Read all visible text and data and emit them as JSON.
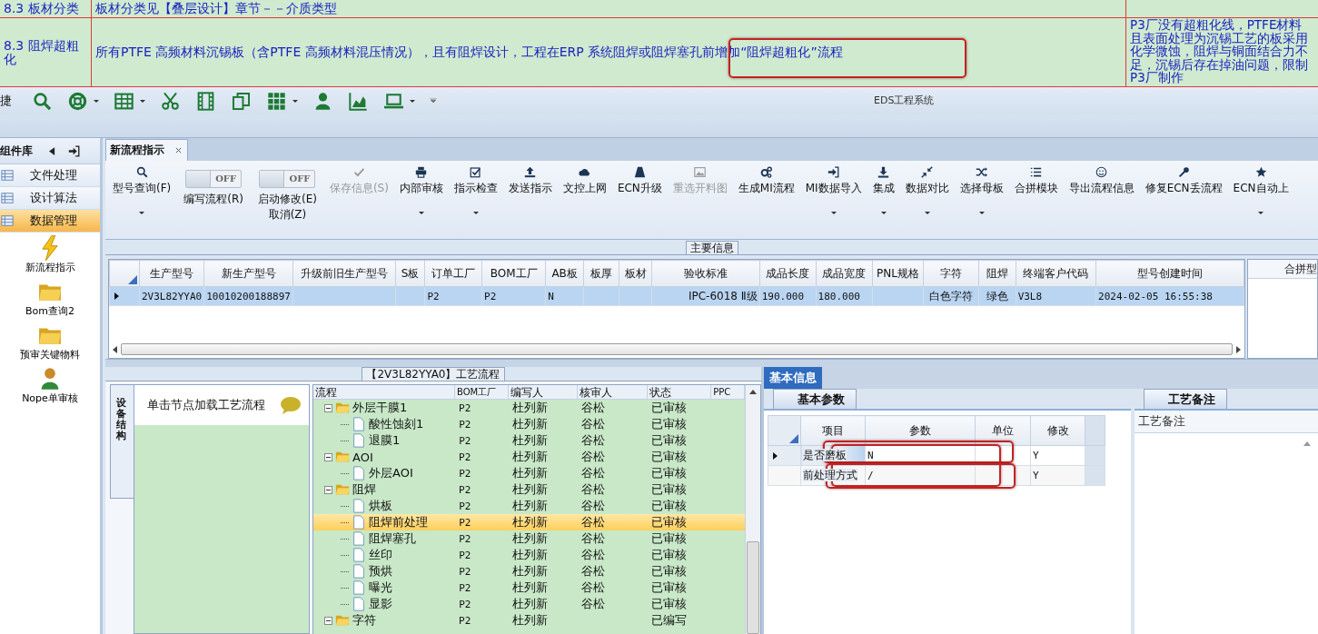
{
  "document_table": {
    "rows": [
      {
        "section": "8.3 板材分类",
        "content": "板材分类见【叠层设计】章节－－介质类型"
      },
      {
        "section": "8.3 阻焊超粗化",
        "content": "所有PTFE 高频材料沉锡板（含PTFE 高频材料混压情况），且有阻焊设计，工程在ERP 系统阻焊或阻焊塞孔前增加“阻焊超粗化”流程",
        "note": "P3厂没有超粗化线，PTFE材料且表面处理为沉锡工艺的板采用化学微蚀，阻焊与铜面结合力不足，沉锡后存在掉油问题，限制P3厂制作"
      }
    ]
  },
  "quick_toolbar": {
    "label": "捷"
  },
  "window": {
    "title": "EDS工程系统"
  },
  "sidebar": {
    "title": "组件库",
    "items": [
      {
        "label": "文件处理",
        "selected": false
      },
      {
        "label": "设计算法",
        "selected": false
      },
      {
        "label": "数据管理",
        "selected": true
      }
    ],
    "shortcuts": [
      "新流程指示",
      "Bom查询2",
      "预审关键物料",
      "Nope单审核"
    ]
  },
  "tabs": [
    {
      "label": "新流程指示",
      "selected": true
    }
  ],
  "ribbon": [
    {
      "kind": "button",
      "label": "型号查询(F)",
      "dropdown": true,
      "disabled": false
    },
    {
      "kind": "toggle",
      "label": "编写流程(R)",
      "state_label": "OFF",
      "on": false
    },
    {
      "kind": "toggle",
      "label": "启动修改(E)",
      "label2": "取消(Z)",
      "state_label": "OFF",
      "on": false
    },
    {
      "kind": "button",
      "label": "保存信息(S)",
      "dropdown": false,
      "disabled": true
    },
    {
      "kind": "button",
      "label": "内部审核",
      "dropdown": true,
      "disabled": false
    },
    {
      "kind": "button",
      "label": "指示检查",
      "dropdown": true,
      "disabled": false
    },
    {
      "kind": "button",
      "label": "发送指示",
      "dropdown": false,
      "disabled": false
    },
    {
      "kind": "button",
      "label": "文控上网",
      "dropdown": false,
      "disabled": false
    },
    {
      "kind": "button",
      "label": "ECN升级",
      "dropdown": false,
      "disabled": false
    },
    {
      "kind": "button",
      "label": "重选开料图",
      "dropdown": false,
      "disabled": true
    },
    {
      "kind": "button",
      "label": "生成MI流程",
      "dropdown": false,
      "disabled": false
    },
    {
      "kind": "button",
      "label": "MI数据导入",
      "dropdown": true,
      "disabled": false
    },
    {
      "kind": "button",
      "label": "集成",
      "dropdown": true,
      "disabled": false
    },
    {
      "kind": "button",
      "label": "数据对比",
      "dropdown": true,
      "disabled": false
    },
    {
      "kind": "button",
      "label": "选择母板",
      "dropdown": true,
      "disabled": false
    },
    {
      "kind": "button",
      "label": "合拼模块",
      "dropdown": false,
      "disabled": false
    },
    {
      "kind": "button",
      "label": "导出流程信息",
      "dropdown": false,
      "disabled": false
    },
    {
      "kind": "button",
      "label": "修复ECN丢流程",
      "dropdown": false,
      "disabled": false
    },
    {
      "kind": "button",
      "label": "ECN自动上",
      "dropdown": true,
      "disabled": false
    }
  ],
  "main_info": {
    "title": "主要信息",
    "columns": [
      "生产型号",
      "新生产型号",
      "升级前旧生产型号",
      "S板",
      "订单工厂",
      "BOM工厂",
      "AB板",
      "板厚",
      "板材",
      "验收标准",
      "成品长度",
      "成品宽度",
      "PNL规格",
      "字符",
      "阻焊",
      "终端客户代码",
      "型号创建时间"
    ],
    "rows": [
      {
        "selected": true,
        "cells": [
          "2V3L82YYA0",
          "10010200188897",
          null,
          null,
          "P2",
          "P2",
          "N",
          null,
          null,
          "IPC-6018 Ⅱ级",
          "190.000",
          "180.000",
          null,
          "白色字符",
          "绿色",
          "V3L8",
          "2024-02-05 16:55:38"
        ]
      }
    ],
    "side_panel": {
      "title": "合拼型"
    }
  },
  "process_panel": {
    "title": "【2V3L82YYA0】工艺流程",
    "side_tab": "设备结构",
    "hint": "单击节点加载工艺流程",
    "columns": [
      "流程",
      "BOM工厂",
      "编写人",
      "核审人",
      "状态",
      "PPC"
    ],
    "nodes": [
      {
        "kind": "folder",
        "label": "外层干膜1",
        "bom": "P2",
        "author": "杜列新",
        "reviewer": "谷松",
        "status": "已审核",
        "selected": false,
        "expanded": true,
        "children": [
          {
            "kind": "file",
            "label": "酸性蚀刻1",
            "bom": "P2",
            "author": "杜列新",
            "reviewer": "谷松",
            "status": "已审核",
            "selected": false
          },
          {
            "kind": "file",
            "label": "退膜1",
            "bom": "P2",
            "author": "杜列新",
            "reviewer": "谷松",
            "status": "已审核",
            "selected": false
          }
        ]
      },
      {
        "kind": "folder",
        "label": "AOI",
        "bom": "P2",
        "author": "杜列新",
        "reviewer": "谷松",
        "status": "已审核",
        "selected": false,
        "expanded": true,
        "children": [
          {
            "kind": "file",
            "label": "外层AOI",
            "bom": "P2",
            "author": "杜列新",
            "reviewer": "谷松",
            "status": "已审核",
            "selected": false
          }
        ]
      },
      {
        "kind": "folder",
        "label": "阻焊",
        "bom": "P2",
        "author": "杜列新",
        "reviewer": "谷松",
        "status": "已审核",
        "selected": false,
        "expanded": true,
        "children": [
          {
            "kind": "file",
            "label": "烘板",
            "bom": "P2",
            "author": "杜列新",
            "reviewer": "谷松",
            "status": "已审核",
            "selected": false
          },
          {
            "kind": "file",
            "label": "阻焊前处理",
            "bom": "P2",
            "author": "杜列新",
            "reviewer": "谷松",
            "status": "已审核",
            "selected": true
          },
          {
            "kind": "file",
            "label": "阻焊塞孔",
            "bom": "P2",
            "author": "杜列新",
            "reviewer": "谷松",
            "status": "已审核",
            "selected": false
          },
          {
            "kind": "file",
            "label": "丝印",
            "bom": "P2",
            "author": "杜列新",
            "reviewer": "谷松",
            "status": "已审核",
            "selected": false
          },
          {
            "kind": "file",
            "label": "预烘",
            "bom": "P2",
            "author": "杜列新",
            "reviewer": "谷松",
            "status": "已审核",
            "selected": false
          },
          {
            "kind": "file",
            "label": "曝光",
            "bom": "P2",
            "author": "杜列新",
            "reviewer": "谷松",
            "status": "已审核",
            "selected": false
          },
          {
            "kind": "file",
            "label": "显影",
            "bom": "P2",
            "author": "杜列新",
            "reviewer": "谷松",
            "status": "已审核",
            "selected": false
          }
        ]
      },
      {
        "kind": "folder",
        "label": "字符",
        "bom": "P2",
        "author": "杜列新",
        "status": "已编写",
        "selected": false,
        "expanded": true
      }
    ]
  },
  "detail": {
    "tab": "基本信息",
    "params_tab": "基本参数",
    "columns": [
      "项目",
      "参数",
      "单位",
      "修改"
    ],
    "rows": [
      {
        "selected": true,
        "cells": [
          "是否磨板",
          "N",
          null,
          "Y"
        ]
      },
      {
        "selected": false,
        "cells": [
          "前处理方式",
          "/",
          null,
          "Y"
        ]
      }
    ],
    "notes_tab": "工艺备注",
    "notes_column": "工艺备注"
  }
}
